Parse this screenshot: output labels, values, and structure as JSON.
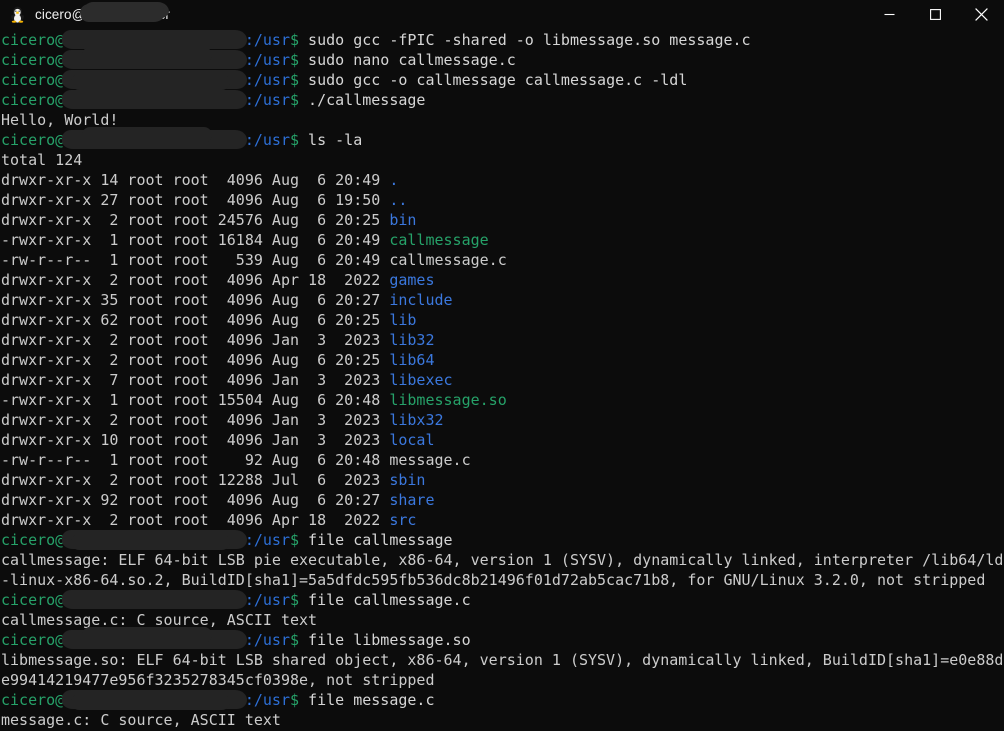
{
  "window": {
    "title": "cicero@",
    "title_suffix": "/usr",
    "icon": "tux-penguin-icon",
    "minimize_label": "Minimize",
    "maximize_label": "Maximize",
    "close_label": "Close"
  },
  "theme": {
    "background": "#0c0c0c",
    "foreground": "#cccccc",
    "prompt_user": "#26a269",
    "prompt_path": "#2d6fd6",
    "dir_color": "#3b78de",
    "exe_color": "#26a269",
    "redaction": "#242424"
  },
  "prompt": {
    "user": "cicero@",
    "host_redacted": "                    ",
    "path": ":/usr",
    "dollar": "$"
  },
  "commands": [
    "sudo gcc -fPIC -shared -o libmessage.so message.c",
    "sudo nano callmessage.c",
    "sudo gcc -o callmessage callmessage.c -ldl",
    "./callmessage",
    "ls -la",
    "file callmessage",
    "file callmessage.c",
    "file libmessage.so",
    "file message.c"
  ],
  "program_output": {
    "hello": "Hello, World!",
    "total": "total 124"
  },
  "ls_listing": [
    {
      "perms": "drwxr-xr-x",
      "links": "14",
      "owner": "root",
      "group": "root",
      "size": "4096",
      "month": "Aug",
      "day": "6",
      "time": "20:49",
      "name": ".",
      "type": "dir"
    },
    {
      "perms": "drwxr-xr-x",
      "links": "27",
      "owner": "root",
      "group": "root",
      "size": "4096",
      "month": "Aug",
      "day": "6",
      "time": "19:50",
      "name": "..",
      "type": "dir"
    },
    {
      "perms": "drwxr-xr-x",
      "links": "2",
      "owner": "root",
      "group": "root",
      "size": "24576",
      "month": "Aug",
      "day": "6",
      "time": "20:25",
      "name": "bin",
      "type": "dir"
    },
    {
      "perms": "-rwxr-xr-x",
      "links": "1",
      "owner": "root",
      "group": "root",
      "size": "16184",
      "month": "Aug",
      "day": "6",
      "time": "20:49",
      "name": "callmessage",
      "type": "exe"
    },
    {
      "perms": "-rw-r--r--",
      "links": "1",
      "owner": "root",
      "group": "root",
      "size": "539",
      "month": "Aug",
      "day": "6",
      "time": "20:49",
      "name": "callmessage.c",
      "type": "file"
    },
    {
      "perms": "drwxr-xr-x",
      "links": "2",
      "owner": "root",
      "group": "root",
      "size": "4096",
      "month": "Apr",
      "day": "18",
      "time": "2022",
      "name": "games",
      "type": "dir"
    },
    {
      "perms": "drwxr-xr-x",
      "links": "35",
      "owner": "root",
      "group": "root",
      "size": "4096",
      "month": "Aug",
      "day": "6",
      "time": "20:27",
      "name": "include",
      "type": "dir"
    },
    {
      "perms": "drwxr-xr-x",
      "links": "62",
      "owner": "root",
      "group": "root",
      "size": "4096",
      "month": "Aug",
      "day": "6",
      "time": "20:25",
      "name": "lib",
      "type": "dir"
    },
    {
      "perms": "drwxr-xr-x",
      "links": "2",
      "owner": "root",
      "group": "root",
      "size": "4096",
      "month": "Jan",
      "day": "3",
      "time": "2023",
      "name": "lib32",
      "type": "dir"
    },
    {
      "perms": "drwxr-xr-x",
      "links": "2",
      "owner": "root",
      "group": "root",
      "size": "4096",
      "month": "Aug",
      "day": "6",
      "time": "20:25",
      "name": "lib64",
      "type": "dir"
    },
    {
      "perms": "drwxr-xr-x",
      "links": "7",
      "owner": "root",
      "group": "root",
      "size": "4096",
      "month": "Jan",
      "day": "3",
      "time": "2023",
      "name": "libexec",
      "type": "dir"
    },
    {
      "perms": "-rwxr-xr-x",
      "links": "1",
      "owner": "root",
      "group": "root",
      "size": "15504",
      "month": "Aug",
      "day": "6",
      "time": "20:48",
      "name": "libmessage.so",
      "type": "exe"
    },
    {
      "perms": "drwxr-xr-x",
      "links": "2",
      "owner": "root",
      "group": "root",
      "size": "4096",
      "month": "Jan",
      "day": "3",
      "time": "2023",
      "name": "libx32",
      "type": "dir"
    },
    {
      "perms": "drwxr-xr-x",
      "links": "10",
      "owner": "root",
      "group": "root",
      "size": "4096",
      "month": "Jan",
      "day": "3",
      "time": "2023",
      "name": "local",
      "type": "dir"
    },
    {
      "perms": "-rw-r--r--",
      "links": "1",
      "owner": "root",
      "group": "root",
      "size": "92",
      "month": "Aug",
      "day": "6",
      "time": "20:48",
      "name": "message.c",
      "type": "file"
    },
    {
      "perms": "drwxr-xr-x",
      "links": "2",
      "owner": "root",
      "group": "root",
      "size": "12288",
      "month": "Jul",
      "day": "6",
      "time": "2023",
      "name": "sbin",
      "type": "dir"
    },
    {
      "perms": "drwxr-xr-x",
      "links": "92",
      "owner": "root",
      "group": "root",
      "size": "4096",
      "month": "Aug",
      "day": "6",
      "time": "20:27",
      "name": "share",
      "type": "dir"
    },
    {
      "perms": "drwxr-xr-x",
      "links": "2",
      "owner": "root",
      "group": "root",
      "size": "4096",
      "month": "Apr",
      "day": "18",
      "time": "2022",
      "name": "src",
      "type": "dir"
    }
  ],
  "file_outputs": {
    "callmessage_line1": "callmessage: ELF 64-bit LSB pie executable, x86-64, version 1 (SYSV), dynamically linked, interpreter /lib64/ld",
    "callmessage_line2": "-linux-x86-64.so.2, BuildID[sha1]=5a5dfdc595fb536dc8b21496f01d72ab5cac71b8, for GNU/Linux 3.2.0, not stripped",
    "callmessage_c": "callmessage.c: C source, ASCII text",
    "libmessage_line1": "libmessage.so: ELF 64-bit LSB shared object, x86-64, version 1 (SYSV), dynamically linked, BuildID[sha1]=e0e88d",
    "libmessage_line2": "e99414219477e956f3235278345cf0398e, not stripped",
    "message_c": "message.c: C source, ASCII text"
  }
}
